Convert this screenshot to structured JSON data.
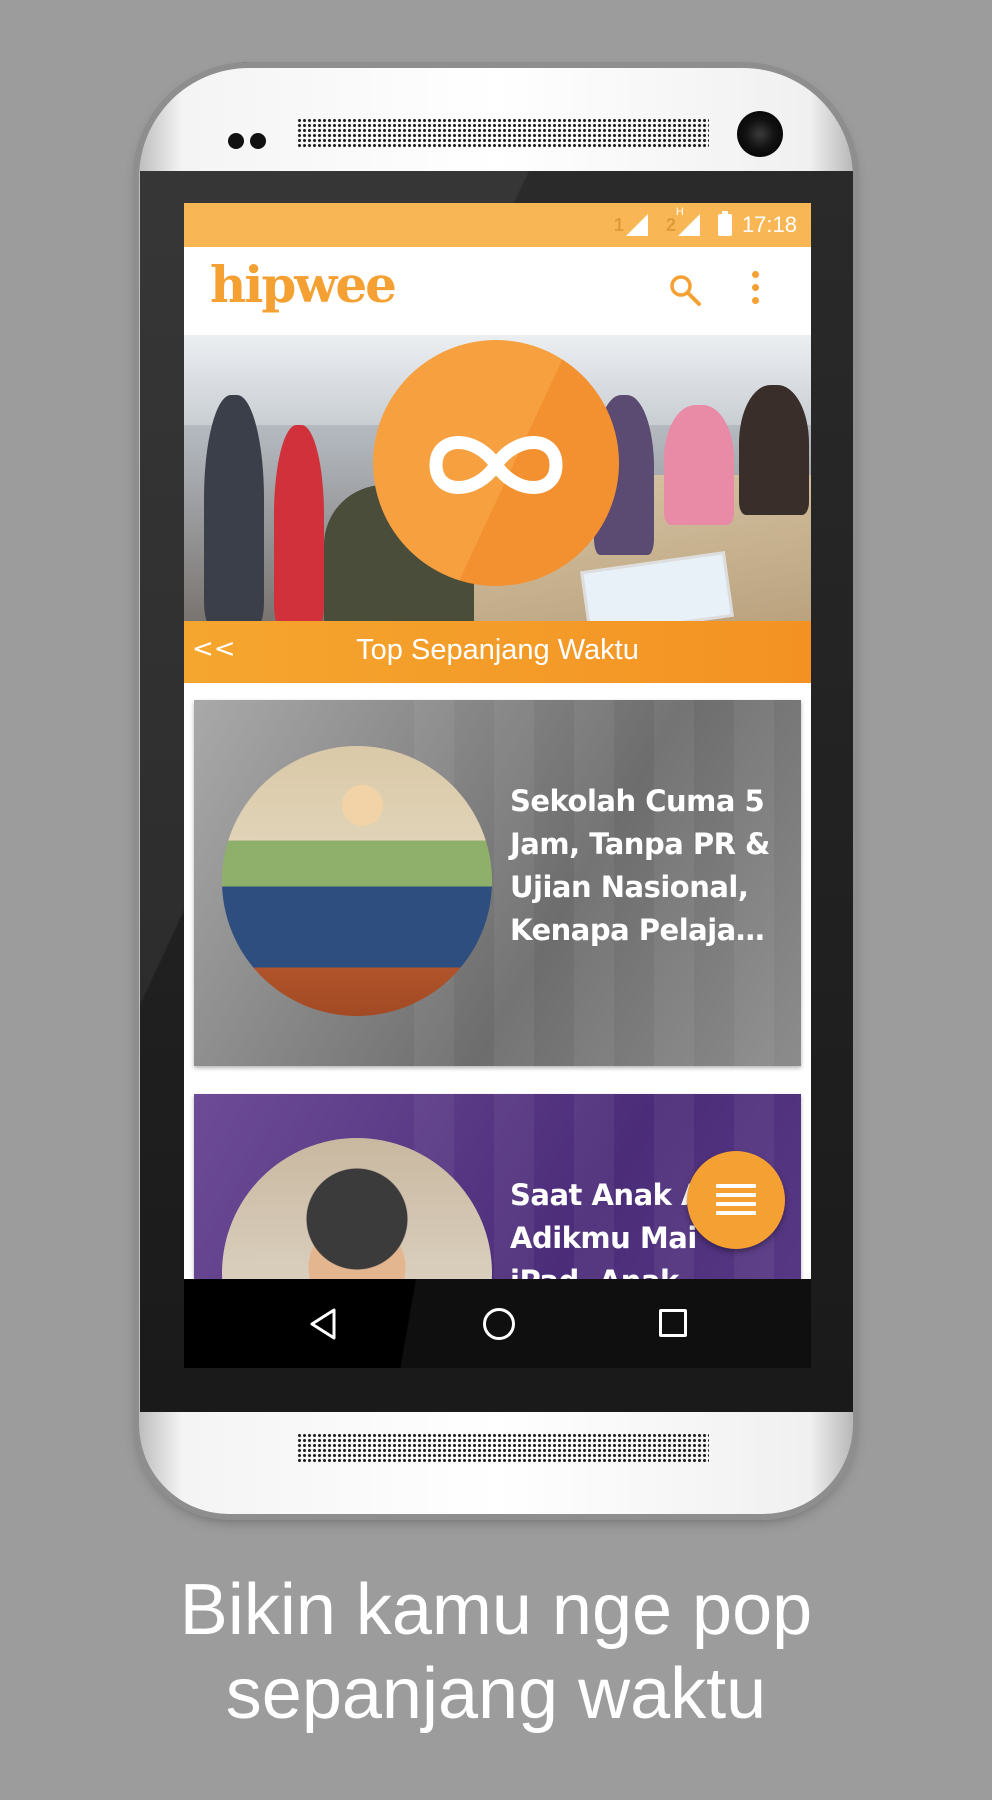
{
  "status_bar": {
    "sim1_label": "1",
    "sim2_label": "2",
    "sim2_network": "H",
    "time": "17:18"
  },
  "app_bar": {
    "logo": "hipwee",
    "icons": [
      "search-icon",
      "overflow-menu-icon"
    ]
  },
  "hero": {
    "badge_icon": "infinity-icon"
  },
  "section": {
    "back_label": "<<",
    "title": "Top Sepanjang Waktu"
  },
  "cards": [
    {
      "title": "Sekolah Cuma 5 Jam, Tanpa PR & Ujian Nasional, Kenapa Pelaja…",
      "tint": "#7a7a7a"
    },
    {
      "title": "Saat Anak A Adikmu Mai iPad, Anak-",
      "tint": "#5a3a86"
    }
  ],
  "fab": {
    "icon": "list-menu-icon"
  },
  "nav_bar": {
    "icons": [
      "nav-back-icon",
      "nav-home-icon",
      "nav-recent-apps-icon"
    ]
  },
  "caption": {
    "line1": "Bikin kamu nge pop",
    "line2": "sepanjang waktu"
  },
  "colors": {
    "accent": "#f5a033",
    "status_bar": "#f8b654",
    "background": "#9c9c9c"
  }
}
